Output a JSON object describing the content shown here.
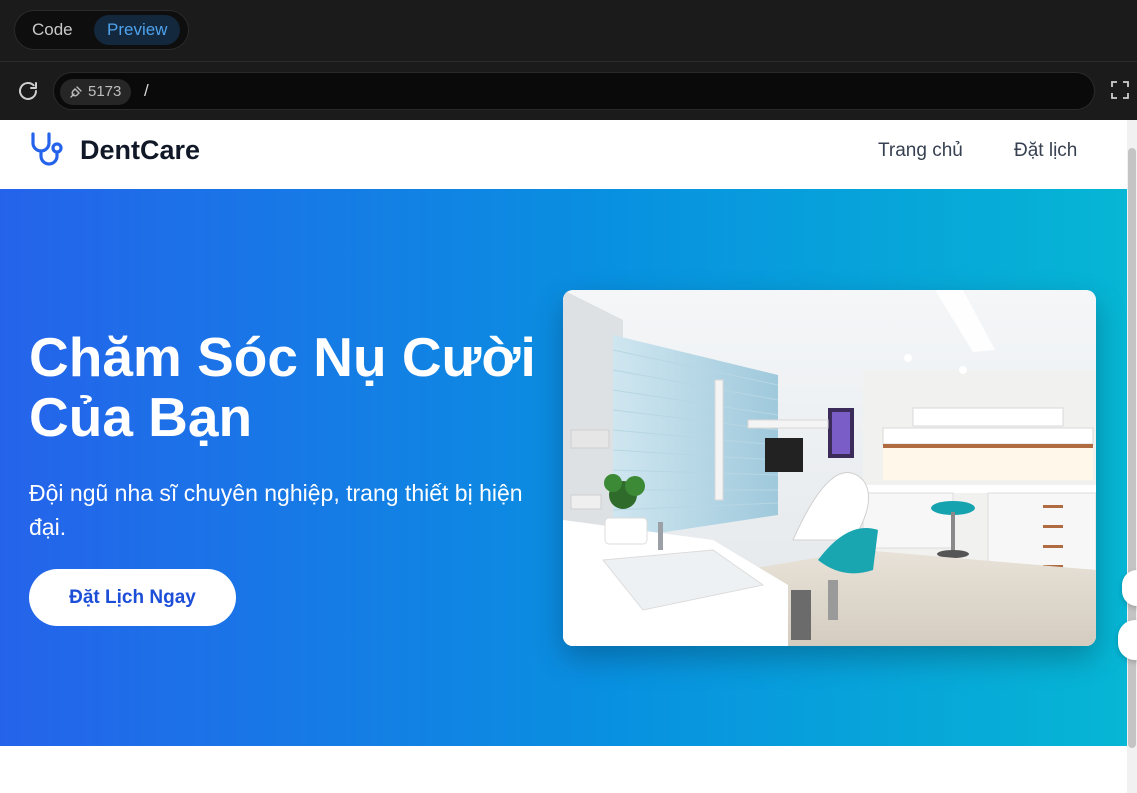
{
  "editor": {
    "tabs": [
      {
        "label": "Code",
        "active": false
      },
      {
        "label": "Preview",
        "active": true
      }
    ],
    "port": "5173",
    "path": "/"
  },
  "site": {
    "brand": "DentCare",
    "nav": [
      {
        "label": "Trang chủ"
      },
      {
        "label": "Đặt lịch"
      }
    ],
    "hero": {
      "title": "Chăm Sóc Nụ Cười Của Bạn",
      "subtitle": "Đội ngũ nha sĩ chuyên nghiệp, trang thiết bị hiện đại.",
      "cta": "Đặt Lịch Ngay"
    }
  },
  "colors": {
    "brand_icon": "#2563eb",
    "gradient_start": "#2563eb",
    "gradient_end": "#06b6d4",
    "preview_tab": "#4ea2ec"
  },
  "icons": [
    "reload-icon",
    "plug-icon",
    "fullscreen-icon",
    "stethoscope-icon"
  ]
}
